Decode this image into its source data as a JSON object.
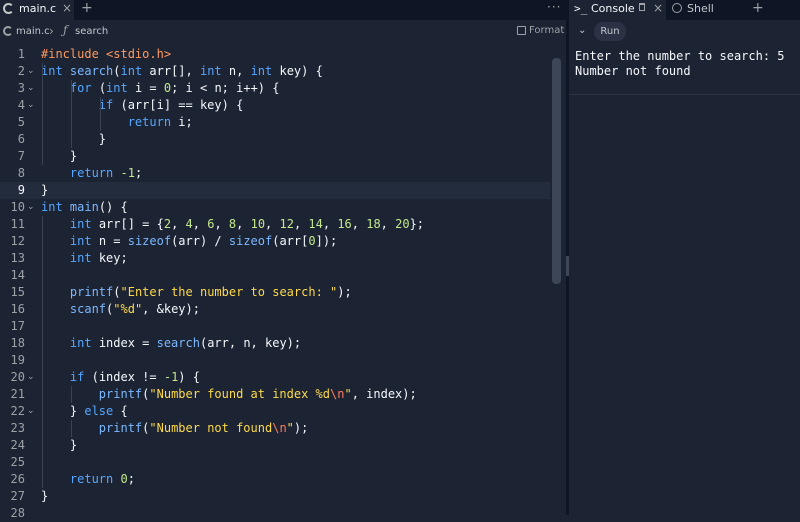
{
  "editor": {
    "tab": {
      "filename": "main.c",
      "close": "×",
      "add": "+",
      "more": "···"
    },
    "breadcrumb": {
      "file": "main.c",
      "separator": "›",
      "fn_icon": "ƒ",
      "symbol": "search",
      "format": "Format"
    },
    "lines": [
      {
        "n": "1",
        "fold": false,
        "tokens": [
          [
            "pre",
            "#include "
          ],
          [
            "inc",
            "<stdio.h>"
          ]
        ]
      },
      {
        "n": "2",
        "fold": true,
        "tokens": [
          [
            "kw",
            "int "
          ],
          [
            "call",
            "search"
          ],
          [
            "",
            "("
          ],
          [
            "kw",
            "int "
          ],
          [
            "",
            "arr[], "
          ],
          [
            "kw",
            "int "
          ],
          [
            "",
            "n, "
          ],
          [
            "kw",
            "int "
          ],
          [
            "",
            "key) {"
          ]
        ]
      },
      {
        "n": "3",
        "fold": true,
        "tokens": [
          [
            "",
            "    "
          ],
          [
            "kw",
            "for "
          ],
          [
            "",
            "("
          ],
          [
            "kw",
            "int "
          ],
          [
            "",
            "i = "
          ],
          [
            "num",
            "0"
          ],
          [
            "",
            "; i < n; i++) {"
          ]
        ]
      },
      {
        "n": "4",
        "fold": true,
        "tokens": [
          [
            "",
            "        "
          ],
          [
            "kw",
            "if "
          ],
          [
            "",
            "(arr[i] == key) {"
          ]
        ]
      },
      {
        "n": "5",
        "fold": false,
        "tokens": [
          [
            "",
            "            "
          ],
          [
            "kw",
            "return "
          ],
          [
            "",
            "i;"
          ]
        ]
      },
      {
        "n": "6",
        "fold": false,
        "tokens": [
          [
            "",
            "        }"
          ]
        ]
      },
      {
        "n": "7",
        "fold": false,
        "tokens": [
          [
            "",
            "    }"
          ]
        ]
      },
      {
        "n": "8",
        "fold": false,
        "tokens": [
          [
            "",
            "    "
          ],
          [
            "kw",
            "return "
          ],
          [
            "num",
            "-1"
          ],
          [
            "",
            ";"
          ]
        ]
      },
      {
        "n": "9",
        "fold": false,
        "active": true,
        "tokens": [
          [
            "",
            "}"
          ]
        ]
      },
      {
        "n": "10",
        "fold": true,
        "tokens": [
          [
            "kw",
            "int "
          ],
          [
            "call",
            "main"
          ],
          [
            "",
            "() {"
          ]
        ]
      },
      {
        "n": "11",
        "fold": false,
        "tokens": [
          [
            "",
            "    "
          ],
          [
            "kw",
            "int "
          ],
          [
            "",
            "arr[] = {"
          ],
          [
            "num",
            "2"
          ],
          [
            "",
            ", "
          ],
          [
            "num",
            "4"
          ],
          [
            "",
            ", "
          ],
          [
            "num",
            "6"
          ],
          [
            "",
            ", "
          ],
          [
            "num",
            "8"
          ],
          [
            "",
            ", "
          ],
          [
            "num",
            "10"
          ],
          [
            "",
            ", "
          ],
          [
            "num",
            "12"
          ],
          [
            "",
            ", "
          ],
          [
            "num",
            "14"
          ],
          [
            "",
            ", "
          ],
          [
            "num",
            "16"
          ],
          [
            "",
            ", "
          ],
          [
            "num",
            "18"
          ],
          [
            "",
            ", "
          ],
          [
            "num",
            "20"
          ],
          [
            "",
            "};"
          ]
        ]
      },
      {
        "n": "12",
        "fold": false,
        "tokens": [
          [
            "",
            "    "
          ],
          [
            "kw",
            "int "
          ],
          [
            "",
            "n = "
          ],
          [
            "call",
            "sizeof"
          ],
          [
            "",
            "(arr) / "
          ],
          [
            "call",
            "sizeof"
          ],
          [
            "",
            "(arr["
          ],
          [
            "num",
            "0"
          ],
          [
            "",
            "]);"
          ]
        ]
      },
      {
        "n": "13",
        "fold": false,
        "tokens": [
          [
            "",
            "    "
          ],
          [
            "kw",
            "int "
          ],
          [
            "",
            "key;"
          ]
        ]
      },
      {
        "n": "14",
        "fold": false,
        "tokens": []
      },
      {
        "n": "15",
        "fold": false,
        "tokens": [
          [
            "",
            "    "
          ],
          [
            "call",
            "printf"
          ],
          [
            "",
            "("
          ],
          [
            "str",
            "\"Enter the number to search: \""
          ],
          [
            "",
            ");"
          ]
        ]
      },
      {
        "n": "16",
        "fold": false,
        "tokens": [
          [
            "",
            "    "
          ],
          [
            "call",
            "scanf"
          ],
          [
            "",
            "("
          ],
          [
            "str",
            "\"%d\""
          ],
          [
            "",
            ", &key);"
          ]
        ]
      },
      {
        "n": "17",
        "fold": false,
        "tokens": []
      },
      {
        "n": "18",
        "fold": false,
        "tokens": [
          [
            "",
            "    "
          ],
          [
            "kw",
            "int "
          ],
          [
            "",
            "index = "
          ],
          [
            "call",
            "search"
          ],
          [
            "",
            "(arr, n, key);"
          ]
        ]
      },
      {
        "n": "19",
        "fold": false,
        "tokens": []
      },
      {
        "n": "20",
        "fold": true,
        "tokens": [
          [
            "",
            "    "
          ],
          [
            "kw",
            "if "
          ],
          [
            "",
            "(index != "
          ],
          [
            "num",
            "-1"
          ],
          [
            "",
            ") {"
          ]
        ]
      },
      {
        "n": "21",
        "fold": false,
        "tokens": [
          [
            "",
            "        "
          ],
          [
            "call",
            "printf"
          ],
          [
            "",
            "("
          ],
          [
            "str",
            "\"Number found at index %d"
          ],
          [
            "esc",
            "\\n"
          ],
          [
            "str",
            "\""
          ],
          [
            "",
            ", index);"
          ]
        ]
      },
      {
        "n": "22",
        "fold": true,
        "tokens": [
          [
            "",
            "    } "
          ],
          [
            "kw",
            "else "
          ],
          [
            "",
            "{"
          ]
        ]
      },
      {
        "n": "23",
        "fold": false,
        "tokens": [
          [
            "",
            "        "
          ],
          [
            "call",
            "printf"
          ],
          [
            "",
            "("
          ],
          [
            "str",
            "\"Number not found"
          ],
          [
            "esc",
            "\\n"
          ],
          [
            "str",
            "\""
          ],
          [
            "",
            ");"
          ]
        ]
      },
      {
        "n": "24",
        "fold": false,
        "tokens": [
          [
            "",
            "    }"
          ]
        ]
      },
      {
        "n": "25",
        "fold": false,
        "tokens": []
      },
      {
        "n": "26",
        "fold": false,
        "tokens": [
          [
            "",
            "    "
          ],
          [
            "kw",
            "return "
          ],
          [
            "num",
            "0"
          ],
          [
            "",
            ";"
          ]
        ]
      },
      {
        "n": "27",
        "fold": false,
        "tokens": [
          [
            "",
            "}"
          ]
        ]
      },
      {
        "n": "28",
        "fold": false,
        "tokens": []
      }
    ]
  },
  "console_pane": {
    "console_tab": {
      "icon": ">_",
      "label": "Console",
      "close": "×"
    },
    "shell_tab": {
      "label": "Shell"
    },
    "add": "+",
    "run_label": "Run",
    "chevron": "⌄",
    "output": [
      "Enter the number to search: 5",
      "Number not found"
    ]
  },
  "colors": {
    "background": "#1c2333",
    "chrome": "#0e1525",
    "keyword": "#56a7ff",
    "string": "#fdd94b",
    "number": "#c3e88d",
    "escape": "#ff7b5c",
    "preprocessor": "#ff9a5c"
  }
}
